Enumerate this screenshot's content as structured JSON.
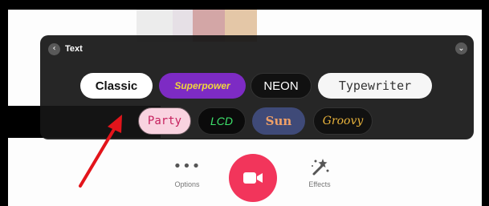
{
  "panel": {
    "title": "Text",
    "back_icon": "chevron-left-icon",
    "collapse_icon": "chevron-down-icon"
  },
  "text_styles": [
    {
      "label": "Classic"
    },
    {
      "label": "Superpower"
    },
    {
      "label": "NEON"
    },
    {
      "label": "Typewriter"
    },
    {
      "label": "Party"
    },
    {
      "label": "LCD"
    },
    {
      "label": "Sun"
    },
    {
      "label": "Groovy"
    }
  ],
  "bottom_bar": {
    "options_label": "Options",
    "effects_label": "Effects",
    "options_icon": "more-dots-icon",
    "record_icon": "video-camera-icon",
    "effects_icon": "magic-wand-icon"
  },
  "colors": {
    "record_accent": "#f2355b",
    "annotation_arrow": "#e3141b",
    "panel_bg": "#161616"
  }
}
